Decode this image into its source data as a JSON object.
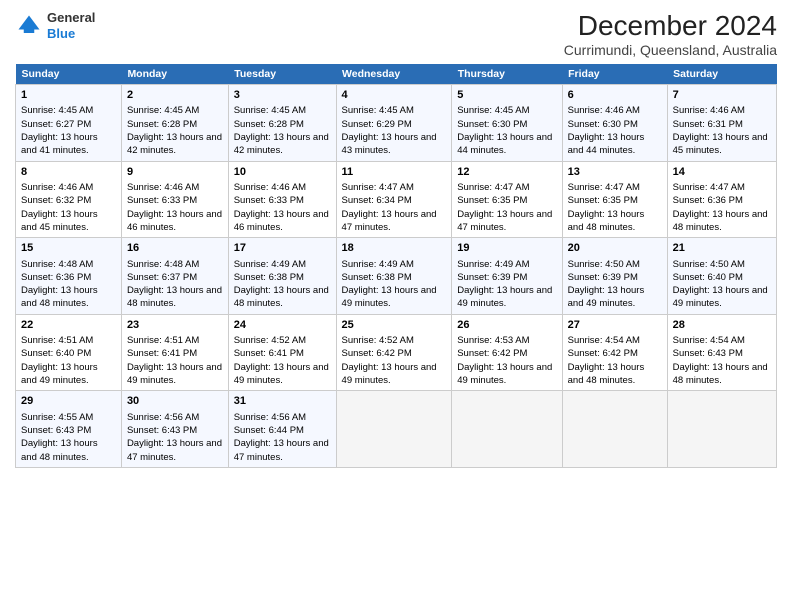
{
  "header": {
    "logo_line1": "General",
    "logo_line2": "Blue",
    "title": "December 2024",
    "subtitle": "Currimundi, Queensland, Australia"
  },
  "days_header": [
    "Sunday",
    "Monday",
    "Tuesday",
    "Wednesday",
    "Thursday",
    "Friday",
    "Saturday"
  ],
  "weeks": [
    [
      {
        "day": "1",
        "info": "Sunrise: 4:45 AM\nSunset: 6:27 PM\nDaylight: 13 hours and 41 minutes."
      },
      {
        "day": "2",
        "info": "Sunrise: 4:45 AM\nSunset: 6:28 PM\nDaylight: 13 hours and 42 minutes."
      },
      {
        "day": "3",
        "info": "Sunrise: 4:45 AM\nSunset: 6:28 PM\nDaylight: 13 hours and 42 minutes."
      },
      {
        "day": "4",
        "info": "Sunrise: 4:45 AM\nSunset: 6:29 PM\nDaylight: 13 hours and 43 minutes."
      },
      {
        "day": "5",
        "info": "Sunrise: 4:45 AM\nSunset: 6:30 PM\nDaylight: 13 hours and 44 minutes."
      },
      {
        "day": "6",
        "info": "Sunrise: 4:46 AM\nSunset: 6:30 PM\nDaylight: 13 hours and 44 minutes."
      },
      {
        "day": "7",
        "info": "Sunrise: 4:46 AM\nSunset: 6:31 PM\nDaylight: 13 hours and 45 minutes."
      }
    ],
    [
      {
        "day": "8",
        "info": "Sunrise: 4:46 AM\nSunset: 6:32 PM\nDaylight: 13 hours and 45 minutes."
      },
      {
        "day": "9",
        "info": "Sunrise: 4:46 AM\nSunset: 6:33 PM\nDaylight: 13 hours and 46 minutes."
      },
      {
        "day": "10",
        "info": "Sunrise: 4:46 AM\nSunset: 6:33 PM\nDaylight: 13 hours and 46 minutes."
      },
      {
        "day": "11",
        "info": "Sunrise: 4:47 AM\nSunset: 6:34 PM\nDaylight: 13 hours and 47 minutes."
      },
      {
        "day": "12",
        "info": "Sunrise: 4:47 AM\nSunset: 6:35 PM\nDaylight: 13 hours and 47 minutes."
      },
      {
        "day": "13",
        "info": "Sunrise: 4:47 AM\nSunset: 6:35 PM\nDaylight: 13 hours and 48 minutes."
      },
      {
        "day": "14",
        "info": "Sunrise: 4:47 AM\nSunset: 6:36 PM\nDaylight: 13 hours and 48 minutes."
      }
    ],
    [
      {
        "day": "15",
        "info": "Sunrise: 4:48 AM\nSunset: 6:36 PM\nDaylight: 13 hours and 48 minutes."
      },
      {
        "day": "16",
        "info": "Sunrise: 4:48 AM\nSunset: 6:37 PM\nDaylight: 13 hours and 48 minutes."
      },
      {
        "day": "17",
        "info": "Sunrise: 4:49 AM\nSunset: 6:38 PM\nDaylight: 13 hours and 48 minutes."
      },
      {
        "day": "18",
        "info": "Sunrise: 4:49 AM\nSunset: 6:38 PM\nDaylight: 13 hours and 49 minutes."
      },
      {
        "day": "19",
        "info": "Sunrise: 4:49 AM\nSunset: 6:39 PM\nDaylight: 13 hours and 49 minutes."
      },
      {
        "day": "20",
        "info": "Sunrise: 4:50 AM\nSunset: 6:39 PM\nDaylight: 13 hours and 49 minutes."
      },
      {
        "day": "21",
        "info": "Sunrise: 4:50 AM\nSunset: 6:40 PM\nDaylight: 13 hours and 49 minutes."
      }
    ],
    [
      {
        "day": "22",
        "info": "Sunrise: 4:51 AM\nSunset: 6:40 PM\nDaylight: 13 hours and 49 minutes."
      },
      {
        "day": "23",
        "info": "Sunrise: 4:51 AM\nSunset: 6:41 PM\nDaylight: 13 hours and 49 minutes."
      },
      {
        "day": "24",
        "info": "Sunrise: 4:52 AM\nSunset: 6:41 PM\nDaylight: 13 hours and 49 minutes."
      },
      {
        "day": "25",
        "info": "Sunrise: 4:52 AM\nSunset: 6:42 PM\nDaylight: 13 hours and 49 minutes."
      },
      {
        "day": "26",
        "info": "Sunrise: 4:53 AM\nSunset: 6:42 PM\nDaylight: 13 hours and 49 minutes."
      },
      {
        "day": "27",
        "info": "Sunrise: 4:54 AM\nSunset: 6:42 PM\nDaylight: 13 hours and 48 minutes."
      },
      {
        "day": "28",
        "info": "Sunrise: 4:54 AM\nSunset: 6:43 PM\nDaylight: 13 hours and 48 minutes."
      }
    ],
    [
      {
        "day": "29",
        "info": "Sunrise: 4:55 AM\nSunset: 6:43 PM\nDaylight: 13 hours and 48 minutes."
      },
      {
        "day": "30",
        "info": "Sunrise: 4:56 AM\nSunset: 6:43 PM\nDaylight: 13 hours and 47 minutes."
      },
      {
        "day": "31",
        "info": "Sunrise: 4:56 AM\nSunset: 6:44 PM\nDaylight: 13 hours and 47 minutes."
      },
      null,
      null,
      null,
      null
    ]
  ]
}
